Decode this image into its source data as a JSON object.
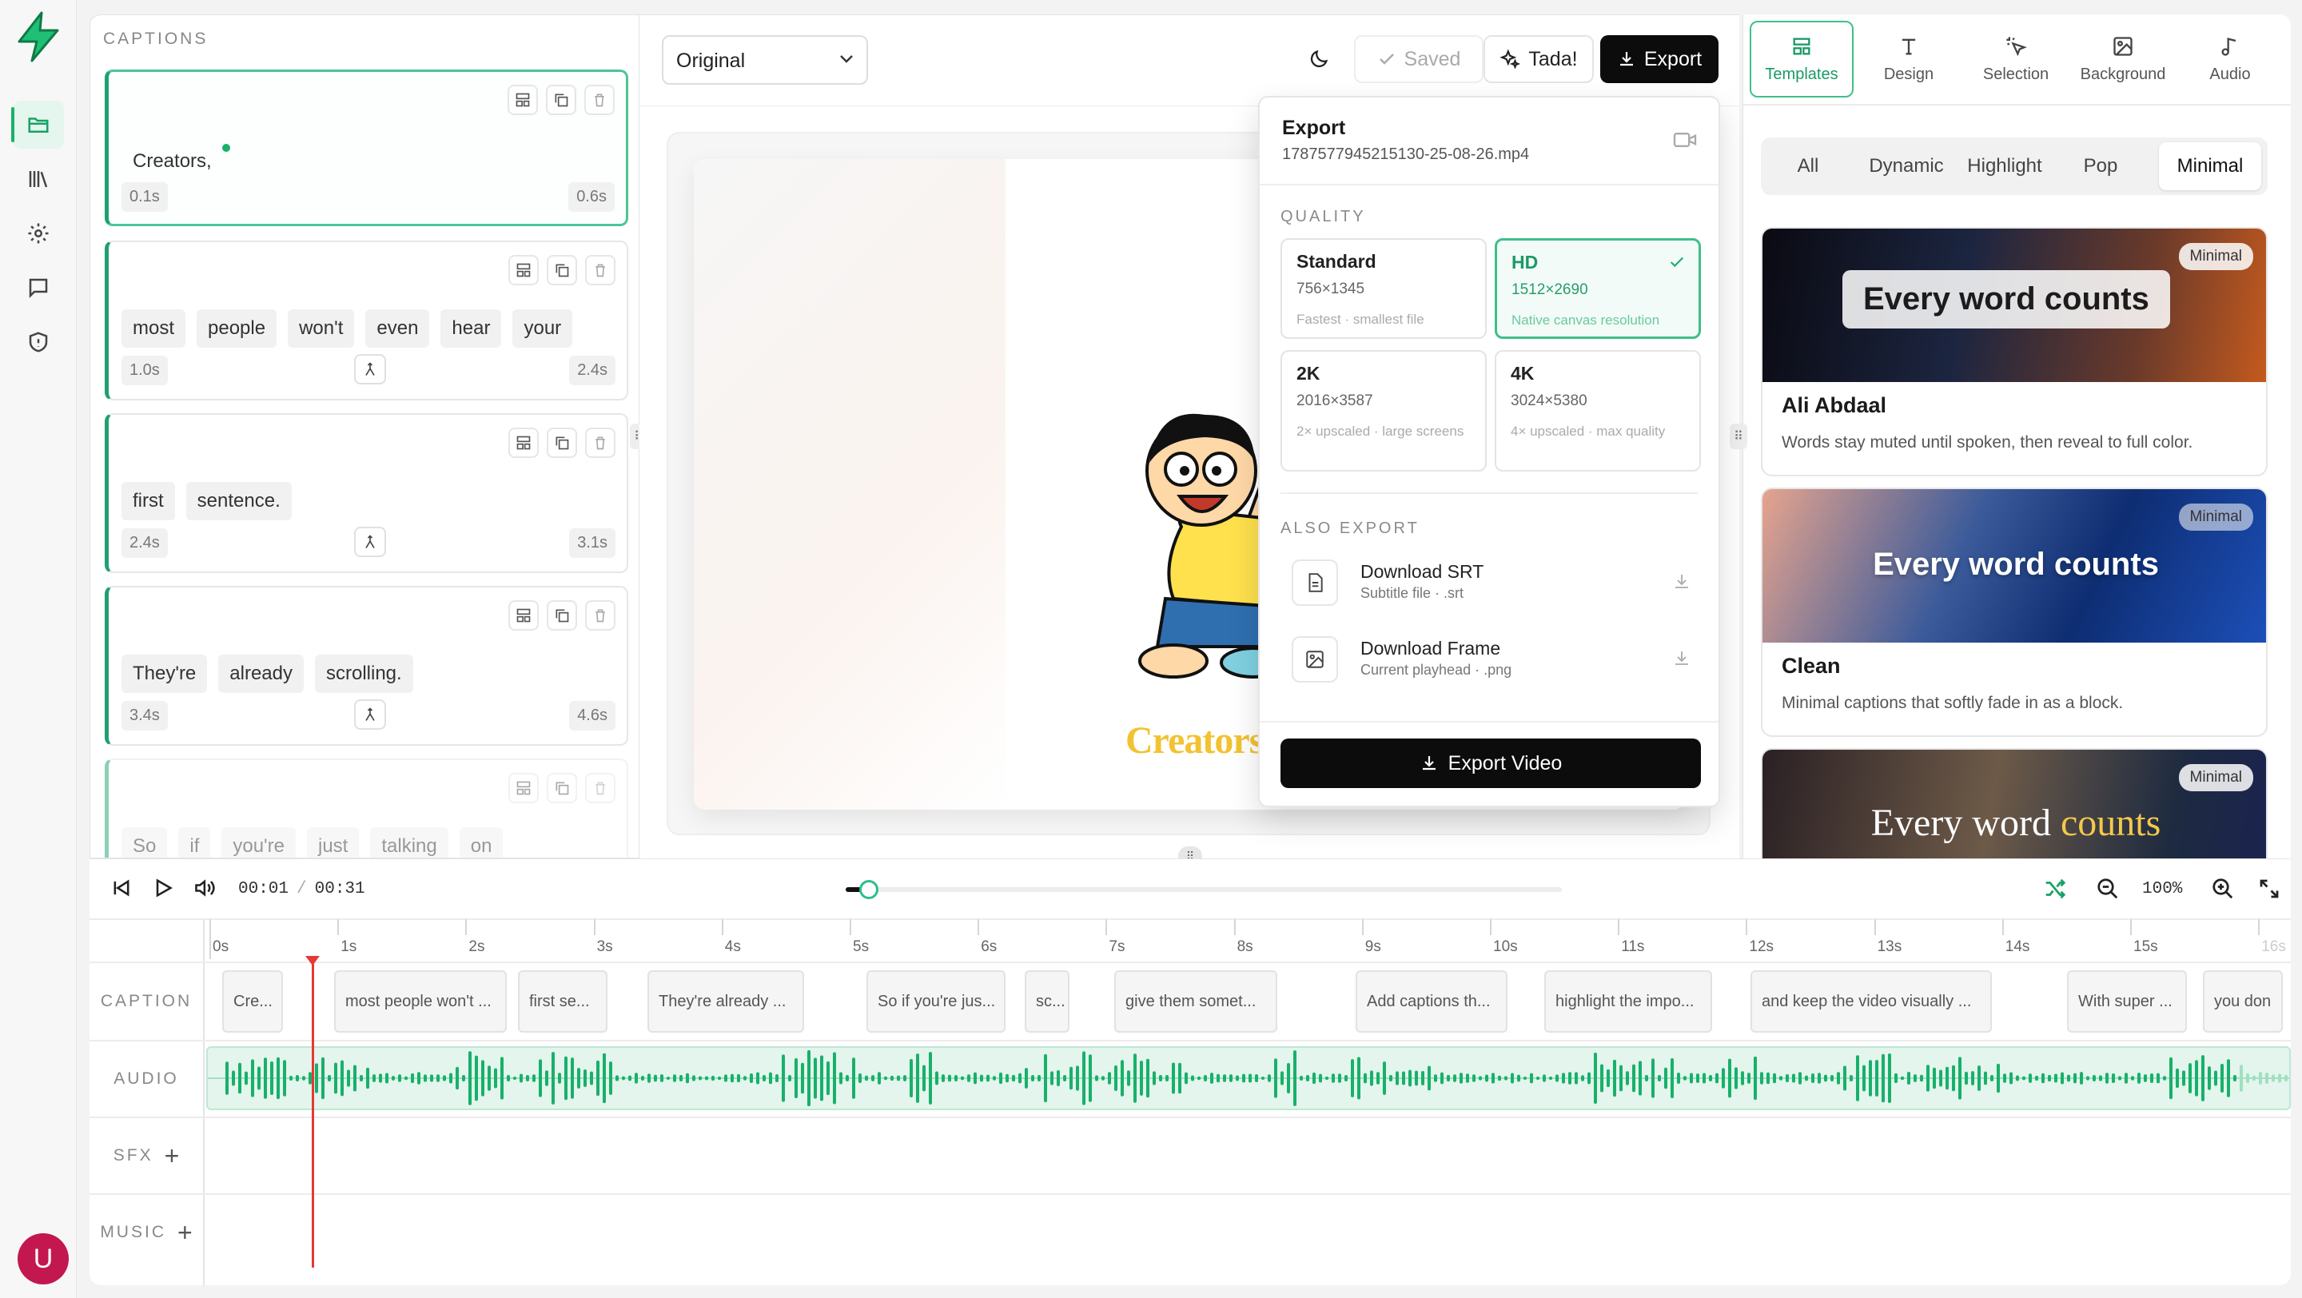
{
  "rail": {
    "items": [
      "Captions",
      "Library",
      "Settings",
      "Feedback",
      "Privacy"
    ],
    "avatar_letter": "U"
  },
  "captions_panel": {
    "title": "CAPTIONS",
    "cards": [
      {
        "words": [
          "Creators,"
        ],
        "start": "0.1s",
        "end": "0.6s",
        "active": true
      },
      {
        "words": [
          "most",
          "people",
          "won't",
          "even",
          "hear",
          "your"
        ],
        "start": "1.0s",
        "end": "2.4s"
      },
      {
        "words": [
          "first",
          "sentence."
        ],
        "start": "2.4s",
        "end": "3.1s"
      },
      {
        "words": [
          "They're",
          "already",
          "scrolling."
        ],
        "start": "3.4s",
        "end": "4.6s"
      },
      {
        "words": [
          "So",
          "if",
          "you're",
          "just",
          "talking",
          "on"
        ]
      }
    ]
  },
  "toolbar": {
    "preset": "Original",
    "saved_label": "Saved",
    "tada_label": "Tada!",
    "export_label": "Export"
  },
  "preview": {
    "caption_word": "Creators,"
  },
  "export_menu": {
    "title": "Export",
    "filename": "1787577945215130-25-08-26.mp4",
    "quality_heading": "QUALITY",
    "qualities": [
      {
        "name": "Standard",
        "dims": "756×1345",
        "sub": "Fastest · smallest file"
      },
      {
        "name": "HD",
        "dims": "1512×2690",
        "sub": "Native canvas resolution",
        "selected": true
      },
      {
        "name": "2K",
        "dims": "2016×3587",
        "sub": "2× upscaled · large screens"
      },
      {
        "name": "4K",
        "dims": "3024×5380",
        "sub": "4× upscaled · max quality"
      }
    ],
    "also_heading": "ALSO EXPORT",
    "srt": {
      "title": "Download SRT",
      "sub": "Subtitle file · .srt"
    },
    "frame": {
      "title": "Download Frame",
      "sub": "Current playhead · .png"
    },
    "export_button": "Export Video"
  },
  "right_panel": {
    "tabs": [
      "Templates",
      "Design",
      "Selection",
      "Background",
      "Audio"
    ],
    "filters": [
      "All",
      "Dynamic",
      "Highlight",
      "Pop",
      "Minimal"
    ],
    "active_filter": "Minimal",
    "templates": [
      {
        "badge": "Minimal",
        "sample": "Every word counts",
        "name": "Ali Abdaal",
        "desc": "Words stay muted until spoken, then reveal to full color."
      },
      {
        "badge": "Minimal",
        "sample": "Every word counts",
        "name": "Clean",
        "desc": "Minimal captions that softly fade in as a block."
      },
      {
        "badge": "Minimal",
        "sample_a": "Every word",
        "sample_b": "counts"
      }
    ]
  },
  "timeline": {
    "current_time": "00:01",
    "separator": "/",
    "total_time": "00:31",
    "zoom": "100%",
    "ticks": [
      "0s",
      "1s",
      "2s",
      "3s",
      "4s",
      "5s",
      "6s",
      "7s",
      "8s",
      "9s",
      "10s",
      "11s",
      "12s",
      "13s",
      "14s",
      "15s",
      "16s"
    ],
    "tracks": {
      "caption": "CAPTION",
      "audio": "AUDIO",
      "sfx": "SFX",
      "music": "MUSIC"
    },
    "caption_clips": [
      "Cre...",
      "most people won't ...",
      "first se...",
      "They're already ...",
      "So if you're jus...",
      "sc...",
      "give them somet...",
      "Add captions th...",
      "highlight the impo...",
      "and keep the video visually ...",
      "With super ...",
      "you don"
    ]
  },
  "colors": {
    "accent": "#17b26a",
    "accent_light": "#e4f6ee",
    "playhead": "#e53935",
    "avatar": "#c3174f"
  }
}
